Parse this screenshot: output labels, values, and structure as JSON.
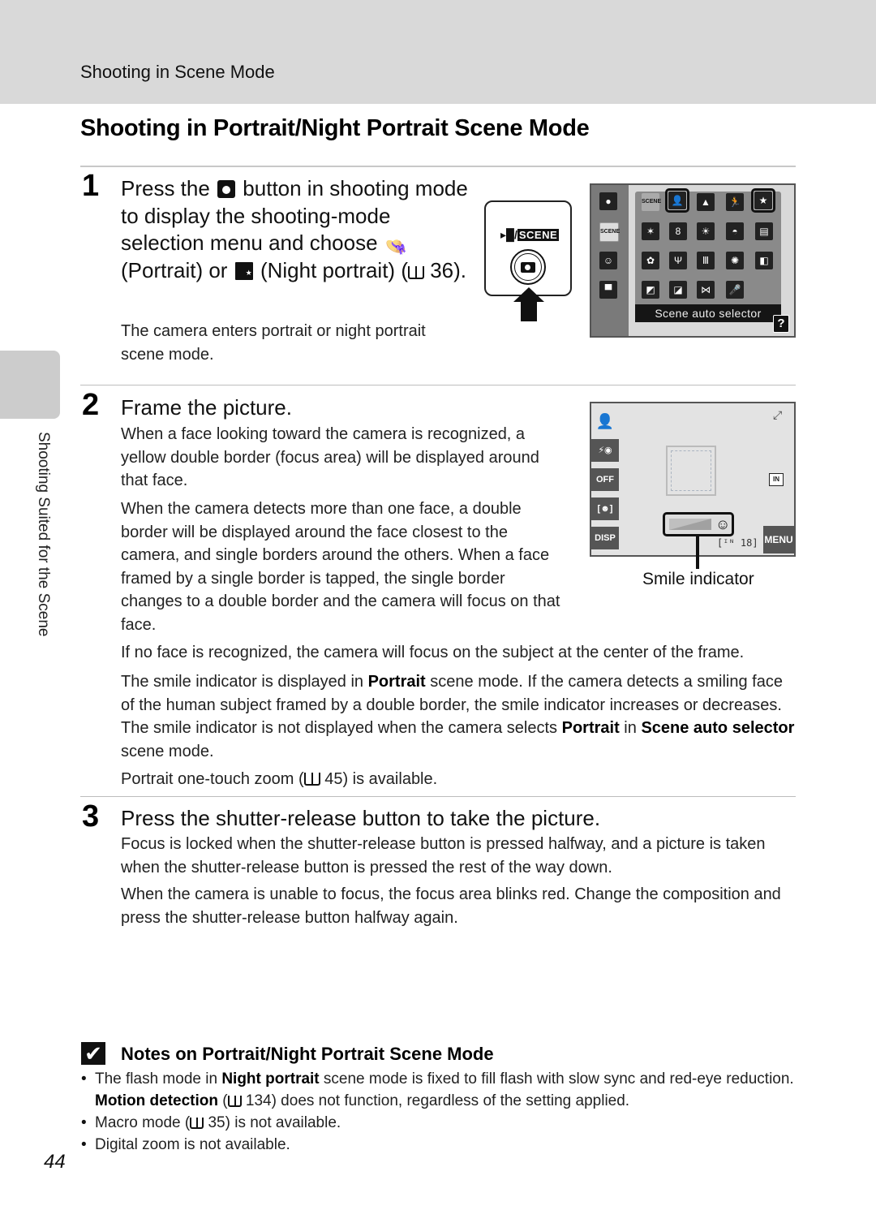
{
  "header": {
    "section": "Shooting in Scene Mode",
    "title": "Shooting in Portrait/Night Portrait Scene Mode"
  },
  "side_tab": {
    "label": "Shooting Suited for the Scene"
  },
  "step1": {
    "number": "1",
    "head_part1": "Press the",
    "head_part2": "button in shooting mode to display the shooting-mode selection menu and choose",
    "head_part3": "(Portrait) or",
    "head_part4": "(Night portrait) (",
    "head_ref": "36).",
    "body": "The camera enters portrait or night portrait scene mode.",
    "button_diagram": {
      "label_movie_icon": "movie-icon",
      "label_sep": "/",
      "label_scene": "SCENE",
      "button_icon": "camera-icon"
    },
    "scene_menu": {
      "caption": "Scene auto selector",
      "help": "?",
      "left_column": [
        "camera-icon",
        "scene-auto-icon",
        "smart-portrait-icon",
        "movie-icon"
      ],
      "grid": [
        [
          "SCENE",
          "portrait",
          "landscape",
          "sports",
          "night-portrait"
        ],
        [
          "party",
          "beach",
          "snow",
          "sunset",
          "dusk"
        ],
        [
          "night-landscape",
          "food",
          "museum",
          "fireworks",
          "copy"
        ],
        [
          "backlighting",
          "panorama",
          "pet",
          "voice"
        ]
      ],
      "selected": [
        "portrait",
        "night-portrait"
      ]
    }
  },
  "step2": {
    "number": "2",
    "head": "Frame the picture.",
    "para1": "When a face looking toward the camera is recognized, a yellow double border (focus area) will be displayed around that face.",
    "para2": "When the camera detects more than one face, a double border will be displayed around the face closest to the camera, and single borders around the others. When a face framed by a single border is tapped, the single border changes to a double border and the camera will focus on that face.",
    "para3": "If no face is recognized, the camera will focus on the subject at the center of the frame.",
    "para4_a": "The smile indicator is displayed in",
    "para4_b": "Portrait",
    "para4_c": "scene mode. If the camera detects a smiling face of the human subject framed by a double border, the smile indicator increases or decreases. The smile indicator is not displayed when the camera selects",
    "para4_d": "Portrait",
    "para4_e": "in",
    "para4_f": "Scene auto selector",
    "para4_g": "scene mode.",
    "para5_a": "Portrait one-touch zoom (",
    "para5_b": "45) is available.",
    "screen": {
      "left_icons": [
        "portrait-icon",
        "flash-redeye-icon",
        "self-timer-off-icon",
        "face-priority-icon",
        "DISP"
      ],
      "self_timer": "OFF",
      "disp": "DISP",
      "menu": "MENU",
      "count": "18",
      "memory": "IN",
      "callout": "Smile indicator"
    }
  },
  "step3": {
    "number": "3",
    "head": "Press the shutter-release button to take the picture.",
    "para1": "Focus is locked when the shutter-release button is pressed halfway, and a picture is taken when the shutter-release button is pressed the rest of the way down.",
    "para2": "When the camera is unable to focus, the focus area blinks red. Change the composition and press the shutter-release button halfway again."
  },
  "notes": {
    "title": "Notes on Portrait/Night Portrait Scene Mode",
    "item1_a": "The flash mode in",
    "item1_b": "Night portrait",
    "item1_c": "scene mode is fixed to fill flash with slow sync and red-eye reduction.",
    "item1_d": "Motion detection",
    "item1_e": "(",
    "item1_f": "134) does not function, regardless of the setting applied.",
    "item2_a": "Macro mode (",
    "item2_b": "35) is not available.",
    "item3": "Digital zoom is not available."
  },
  "page_number": "44"
}
